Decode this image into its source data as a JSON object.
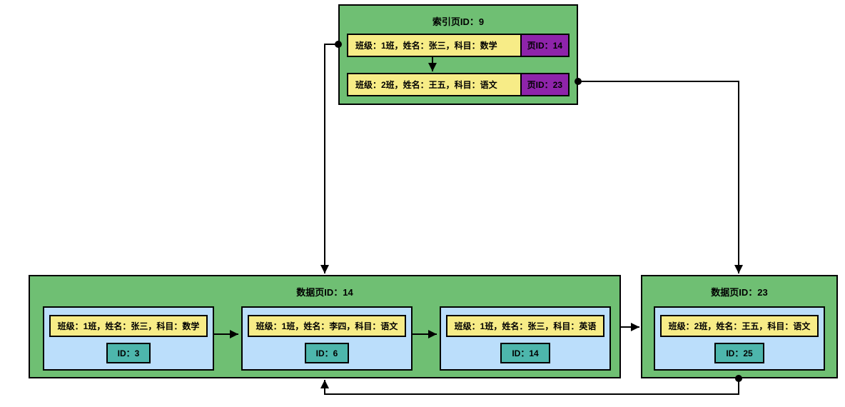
{
  "index_page": {
    "title": "索引页ID：9",
    "rows": [
      {
        "key": "班级：1班，姓名：张三，科目：数学",
        "page_id_label": "页ID：14"
      },
      {
        "key": "班级：2班，姓名：王五，科目：语文",
        "page_id_label": "页ID：23"
      }
    ]
  },
  "data_pages": [
    {
      "title": "数据页ID：14",
      "records": [
        {
          "key": "班级：1班，姓名：张三，科目：数学",
          "id_label": "ID：3"
        },
        {
          "key": "班级：1班，姓名：李四，科目：语文",
          "id_label": "ID：6"
        },
        {
          "key": "班级：1班，姓名：张三，科目：英语",
          "id_label": "ID：14"
        }
      ]
    },
    {
      "title": "数据页ID：23",
      "records": [
        {
          "key": "班级：2班，姓名：王五，科目：语文",
          "id_label": "ID：25"
        }
      ]
    }
  ],
  "colors": {
    "page_bg": "#6fbf73",
    "key_bg": "#f7ec87",
    "pid_bg": "#8e24aa",
    "record_bg": "#bbdefb",
    "id_bg": "#4db6ac"
  }
}
